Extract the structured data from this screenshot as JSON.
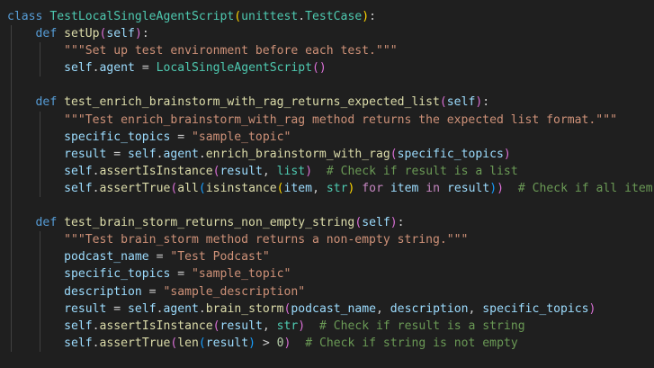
{
  "colors": {
    "background": "#1f1f1f",
    "keyword": "#569cd6",
    "control": "#c586c0",
    "class": "#4ec9b0",
    "function": "#dcdcaa",
    "variable": "#9cdcfe",
    "string": "#ce9178",
    "number": "#b5cea8",
    "comment": "#6a9955",
    "bracket_1": "#ffd700",
    "bracket_2": "#da70d6",
    "bracket_3": "#179fff"
  },
  "code_lines": [
    [
      [
        "kw",
        "class"
      ],
      [
        "pun",
        " "
      ],
      [
        "cls",
        "TestLocalSingleAgentScript"
      ],
      [
        "br1",
        "("
      ],
      [
        "cls",
        "unittest"
      ],
      [
        "pun",
        "."
      ],
      [
        "cls",
        "TestCase"
      ],
      [
        "br1",
        ")"
      ],
      [
        "pun",
        ":"
      ]
    ],
    [
      [
        "pun",
        "    "
      ],
      [
        "kw",
        "def"
      ],
      [
        "pun",
        " "
      ],
      [
        "fn",
        "setUp"
      ],
      [
        "br2",
        "("
      ],
      [
        "self",
        "self"
      ],
      [
        "br2",
        ")"
      ],
      [
        "pun",
        ":"
      ]
    ],
    [
      [
        "pun",
        "        "
      ],
      [
        "str",
        "\"\"\"Set up test environment before each test.\"\"\""
      ]
    ],
    [
      [
        "pun",
        "        "
      ],
      [
        "self",
        "self"
      ],
      [
        "pun",
        "."
      ],
      [
        "var",
        "agent"
      ],
      [
        "pun",
        " = "
      ],
      [
        "cls",
        "LocalSingleAgentScript"
      ],
      [
        "br2",
        "("
      ],
      [
        "br2",
        ")"
      ]
    ],
    [],
    [
      [
        "pun",
        "    "
      ],
      [
        "kw",
        "def"
      ],
      [
        "pun",
        " "
      ],
      [
        "fn",
        "test_enrich_brainstorm_with_rag_returns_expected_list"
      ],
      [
        "br2",
        "("
      ],
      [
        "self",
        "self"
      ],
      [
        "br2",
        ")"
      ],
      [
        "pun",
        ":"
      ]
    ],
    [
      [
        "pun",
        "        "
      ],
      [
        "str",
        "\"\"\"Test enrich_brainstorm_with_rag method returns the expected list format.\"\"\""
      ]
    ],
    [
      [
        "pun",
        "        "
      ],
      [
        "var",
        "specific_topics"
      ],
      [
        "pun",
        " = "
      ],
      [
        "str",
        "\"sample_topic\""
      ]
    ],
    [
      [
        "pun",
        "        "
      ],
      [
        "var",
        "result"
      ],
      [
        "pun",
        " = "
      ],
      [
        "self",
        "self"
      ],
      [
        "pun",
        "."
      ],
      [
        "var",
        "agent"
      ],
      [
        "pun",
        "."
      ],
      [
        "fn",
        "enrich_brainstorm_with_rag"
      ],
      [
        "br2",
        "("
      ],
      [
        "var",
        "specific_topics"
      ],
      [
        "br2",
        ")"
      ]
    ],
    [
      [
        "pun",
        "        "
      ],
      [
        "self",
        "self"
      ],
      [
        "pun",
        "."
      ],
      [
        "fn",
        "assertIsInstance"
      ],
      [
        "br2",
        "("
      ],
      [
        "var",
        "result"
      ],
      [
        "pun",
        ", "
      ],
      [
        "cls",
        "list"
      ],
      [
        "br2",
        ")"
      ],
      [
        "pun",
        "  "
      ],
      [
        "cmt",
        "# Check if result is a list"
      ]
    ],
    [
      [
        "pun",
        "        "
      ],
      [
        "self",
        "self"
      ],
      [
        "pun",
        "."
      ],
      [
        "fn",
        "assertTrue"
      ],
      [
        "br2",
        "("
      ],
      [
        "fn",
        "all"
      ],
      [
        "br3",
        "("
      ],
      [
        "fn",
        "isinstance"
      ],
      [
        "br1",
        "("
      ],
      [
        "var",
        "item"
      ],
      [
        "pun",
        ", "
      ],
      [
        "cls",
        "str"
      ],
      [
        "br1",
        ")"
      ],
      [
        "pun",
        " "
      ],
      [
        "ctrl",
        "for"
      ],
      [
        "pun",
        " "
      ],
      [
        "var",
        "item"
      ],
      [
        "pun",
        " "
      ],
      [
        "ctrl",
        "in"
      ],
      [
        "pun",
        " "
      ],
      [
        "var",
        "result"
      ],
      [
        "br3",
        ")"
      ],
      [
        "br2",
        ")"
      ],
      [
        "pun",
        "  "
      ],
      [
        "cmt",
        "# Check if all items are strings"
      ]
    ],
    [],
    [
      [
        "pun",
        "    "
      ],
      [
        "kw",
        "def"
      ],
      [
        "pun",
        " "
      ],
      [
        "fn",
        "test_brain_storm_returns_non_empty_string"
      ],
      [
        "br2",
        "("
      ],
      [
        "self",
        "self"
      ],
      [
        "br2",
        ")"
      ],
      [
        "pun",
        ":"
      ]
    ],
    [
      [
        "pun",
        "        "
      ],
      [
        "str",
        "\"\"\"Test brain_storm method returns a non-empty string.\"\"\""
      ]
    ],
    [
      [
        "pun",
        "        "
      ],
      [
        "var",
        "podcast_name"
      ],
      [
        "pun",
        " = "
      ],
      [
        "str",
        "\"Test Podcast\""
      ]
    ],
    [
      [
        "pun",
        "        "
      ],
      [
        "var",
        "specific_topics"
      ],
      [
        "pun",
        " = "
      ],
      [
        "str",
        "\"sample_topic\""
      ]
    ],
    [
      [
        "pun",
        "        "
      ],
      [
        "var",
        "description"
      ],
      [
        "pun",
        " = "
      ],
      [
        "str",
        "\"sample_description\""
      ]
    ],
    [
      [
        "pun",
        "        "
      ],
      [
        "var",
        "result"
      ],
      [
        "pun",
        " = "
      ],
      [
        "self",
        "self"
      ],
      [
        "pun",
        "."
      ],
      [
        "var",
        "agent"
      ],
      [
        "pun",
        "."
      ],
      [
        "fn",
        "brain_storm"
      ],
      [
        "br2",
        "("
      ],
      [
        "var",
        "podcast_name"
      ],
      [
        "pun",
        ", "
      ],
      [
        "var",
        "description"
      ],
      [
        "pun",
        ", "
      ],
      [
        "var",
        "specific_topics"
      ],
      [
        "br2",
        ")"
      ]
    ],
    [
      [
        "pun",
        "        "
      ],
      [
        "self",
        "self"
      ],
      [
        "pun",
        "."
      ],
      [
        "fn",
        "assertIsInstance"
      ],
      [
        "br2",
        "("
      ],
      [
        "var",
        "result"
      ],
      [
        "pun",
        ", "
      ],
      [
        "cls",
        "str"
      ],
      [
        "br2",
        ")"
      ],
      [
        "pun",
        "  "
      ],
      [
        "cmt",
        "# Check if result is a string"
      ]
    ],
    [
      [
        "pun",
        "        "
      ],
      [
        "self",
        "self"
      ],
      [
        "pun",
        "."
      ],
      [
        "fn",
        "assertTrue"
      ],
      [
        "br2",
        "("
      ],
      [
        "fn",
        "len"
      ],
      [
        "br3",
        "("
      ],
      [
        "var",
        "result"
      ],
      [
        "br3",
        ")"
      ],
      [
        "pun",
        " > "
      ],
      [
        "num",
        "0"
      ],
      [
        "br2",
        ")"
      ],
      [
        "pun",
        "  "
      ],
      [
        "cmt",
        "# Check if string is not empty"
      ]
    ]
  ]
}
